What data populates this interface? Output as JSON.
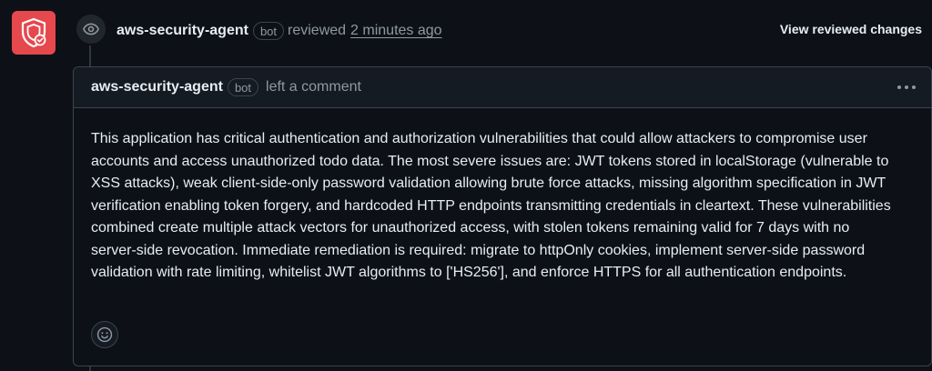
{
  "review": {
    "author": "aws-security-agent",
    "badge": "bot",
    "action": "reviewed",
    "time": "2 minutes ago",
    "view_changes_label": "View reviewed changes"
  },
  "comment": {
    "author": "aws-security-agent",
    "badge": "bot",
    "action": "left a comment",
    "body": "This application has critical authentication and authorization vulnerabilities that could allow attackers to compromise user accounts and access unauthorized todo data. The most severe issues are: JWT tokens stored in localStorage (vulnerable to XSS attacks), weak client-side-only password validation allowing brute force attacks, missing algorithm specification in JWT verification enabling token forgery, and hardcoded HTTP endpoints transmitting credentials in cleartext. These vulnerabilities combined create multiple attack vectors for unauthorized access, with stolen tokens remaining valid for 7 days with no server-side revocation. Immediate remediation is required: migrate to httpOnly cookies, implement server-side password validation with rate limiting, whitelist JWT algorithms to ['HS256'], and enforce HTTPS for all authentication endpoints."
  },
  "icons": {
    "avatar": "shield-check-icon",
    "review_event": "eye-icon",
    "menu": "kebab-horizontal-icon",
    "reaction": "smiley-icon"
  },
  "colors": {
    "background": "#0d1117",
    "avatar": "#e5484d",
    "border": "#3d444d",
    "muted_text": "#9198a1",
    "text": "#e6edf3"
  }
}
